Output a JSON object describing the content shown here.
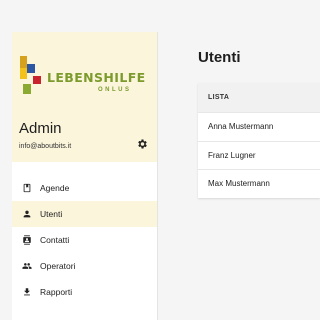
{
  "brand": {
    "name": "LEBENSHILFE",
    "sub": "ONLUS"
  },
  "user": {
    "name": "Admin",
    "email": "info@aboutbits.it"
  },
  "nav": [
    {
      "label": "Agende",
      "icon": "book-icon",
      "active": false
    },
    {
      "label": "Utenti",
      "icon": "person-icon",
      "active": true
    },
    {
      "label": "Contatti",
      "icon": "contact-card-icon",
      "active": false
    },
    {
      "label": "Operatori",
      "icon": "people-icon",
      "active": false
    },
    {
      "label": "Rapporti",
      "icon": "download-icon",
      "active": false
    }
  ],
  "page": {
    "title": "Utenti"
  },
  "table": {
    "header": "LISTA",
    "rows": [
      "Anna Mustermann",
      "Franz Lugner",
      "Max Mustermann"
    ]
  },
  "colors": {
    "accent_bg": "#fbf5dc",
    "brand_green": "#7c9b2c"
  }
}
